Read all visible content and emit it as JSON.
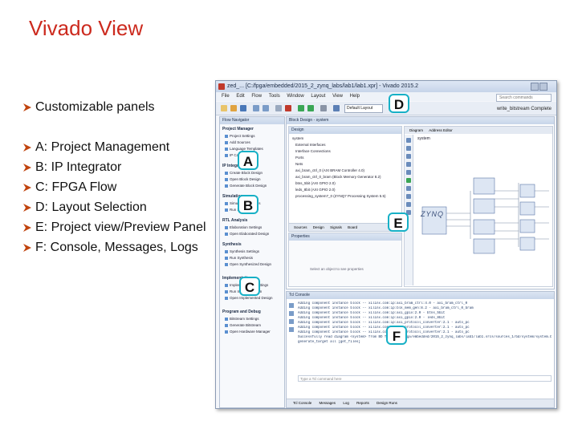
{
  "slide_title": "Vivado View",
  "bullets": [
    "Customizable panels",
    "A: Project Management",
    "B: IP Integrator",
    "C: FPGA Flow",
    "D: Layout Selection",
    "E: Project view/Preview Panel",
    "F: Console, Messages, Logs"
  ],
  "callouts": {
    "a": "A",
    "b": "B",
    "c": "C",
    "d": "D",
    "e": "E",
    "f": "F"
  },
  "colors": {
    "title": "#cc2a1e",
    "callout_border": "#17b0c6",
    "bullet": "#c1440e"
  },
  "screenshot": {
    "window_title": "zed_... [C:/fpga/embedded/2015_2_zynq_labs/lab1/lab1.xpr] - Vivado 2015.2",
    "menu": [
      "File",
      "Edit",
      "Flow",
      "Tools",
      "Window",
      "Layout",
      "View",
      "Help"
    ],
    "search_placeholder": "Search commands",
    "layout_select": "Default Layout",
    "status": "write_bitstream Complete",
    "flow_navigator": {
      "header": "Flow Navigator",
      "sections": [
        {
          "name": "Project Manager",
          "items": [
            "Project Settings",
            "Add Sources",
            "Language Templates",
            "IP Catalog"
          ]
        },
        {
          "name": "IP Integrator",
          "items": [
            "Create Block Design",
            "Open Block Design",
            "Generate Block Design"
          ]
        },
        {
          "name": "Simulation",
          "items": [
            "Simulation Settings",
            "Run Simulation"
          ]
        },
        {
          "name": "RTL Analysis",
          "items": [
            "Elaboration Settings",
            "Open Elaborated Design"
          ]
        },
        {
          "name": "Synthesis",
          "items": [
            "Synthesis Settings",
            "Run Synthesis",
            "Open Synthesized Design"
          ]
        },
        {
          "name": "Implementation",
          "items": [
            "Implementation Settings",
            "Run Implementation",
            "Open Implemented Design"
          ]
        },
        {
          "name": "Program and Debug",
          "items": [
            "Bitstream Settings",
            "Generate Bitstream",
            "Open Hardware Manager"
          ]
        }
      ]
    },
    "block_design": {
      "header": "Block Design - system",
      "design_header": "Design",
      "tree": [
        "system",
        "External Interfaces",
        "Interface Connections",
        "Ports",
        "Nets",
        "axi_bram_ctrl_0 (AXI BRAM Controller 4.0)",
        "axi_bram_ctrl_0_bram (Block Memory Generator 8.2)",
        "btns_5bit (AXI GPIO 2.0)",
        "leds_8bit (AXI GPIO 2.0)",
        "processing_system7_0 (ZYNQ7 Processing System 5.5)"
      ],
      "design_tabs": [
        "Sources",
        "Design",
        "Signals",
        "Board"
      ],
      "properties_header": "Properties",
      "properties_msg": "Select an object to see properties",
      "diagram_tabs": [
        "Diagram",
        "Address Editor"
      ],
      "diagram_label": "system",
      "zynq_label": "ZYNQ"
    },
    "console": {
      "header": "Tcl Console",
      "lines": [
        "Adding component instance block -- xilinx.com:ip:axi_bram_ctrl:4.0 - axi_bram_ctrl_0",
        "Adding component instance block -- xilinx.com:ip:blk_mem_gen:8.2 - axi_bram_ctrl_0_bram",
        "Adding component instance block -- xilinx.com:ip:axi_gpio:2.0 - btns_5bit",
        "Adding component instance block -- xilinx.com:ip:axi_gpio:2.0 - leds_8bit",
        "Adding component instance block -- xilinx.com:ip:axi_protocol_converter:2.1 - auto_pc",
        "Adding component instance block -- xilinx.com:ip:axi_protocol_converter:2.1 - auto_pc",
        "Adding component instance block -- xilinx.com:ip:axi_protocol_converter:2.1 - auto_pc",
        "Successfully read diagram <system> from BD file <C:/fpga/embedded/2015_2_zynq_labs/lab1/lab1.srcs/sources_1/bd/system/system.bd>",
        "generate_target all [get_files]"
      ],
      "input_placeholder": "Type a Tcl command here",
      "tabs": [
        "Tcl Console",
        "Messages",
        "Log",
        "Reports",
        "Design Runs"
      ]
    }
  }
}
